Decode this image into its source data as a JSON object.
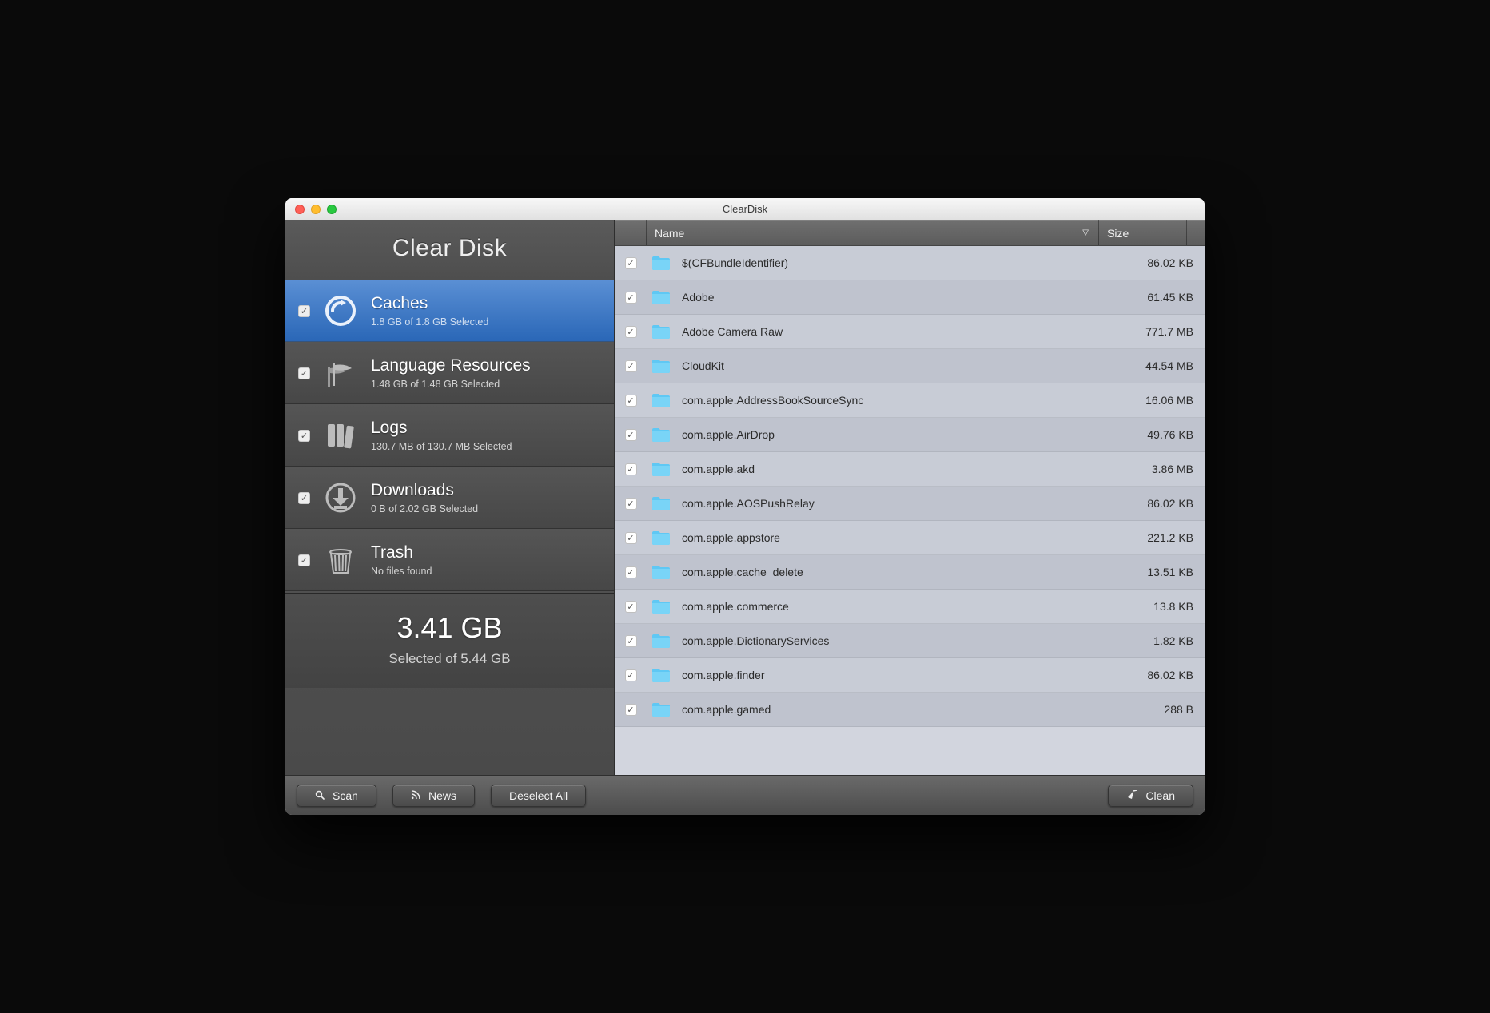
{
  "window": {
    "title": "ClearDisk"
  },
  "app_title": "Clear Disk",
  "categories": [
    {
      "title": "Caches",
      "sub": "1.8 GB of 1.8 GB Selected",
      "checked": true,
      "active": true,
      "icon": "caches"
    },
    {
      "title": "Language Resources",
      "sub": "1.48 GB of 1.48 GB Selected",
      "checked": true,
      "active": false,
      "icon": "language"
    },
    {
      "title": "Logs",
      "sub": "130.7 MB of 130.7 MB Selected",
      "checked": true,
      "active": false,
      "icon": "logs"
    },
    {
      "title": "Downloads",
      "sub": "0 B of 2.02 GB Selected",
      "checked": true,
      "active": false,
      "icon": "downloads"
    },
    {
      "title": "Trash",
      "sub": "No files found",
      "checked": true,
      "active": false,
      "icon": "trash"
    }
  ],
  "totals": {
    "big": "3.41 GB",
    "sub": "Selected of 5.44 GB"
  },
  "columns": {
    "name": "Name",
    "size": "Size"
  },
  "files": [
    {
      "name": "$(CFBundleIdentifier)",
      "size": "86.02 KB",
      "checked": true
    },
    {
      "name": "Adobe",
      "size": "61.45 KB",
      "checked": true
    },
    {
      "name": "Adobe Camera Raw",
      "size": "771.7 MB",
      "checked": true
    },
    {
      "name": "CloudKit",
      "size": "44.54 MB",
      "checked": true
    },
    {
      "name": "com.apple.AddressBookSourceSync",
      "size": "16.06 MB",
      "checked": true
    },
    {
      "name": "com.apple.AirDrop",
      "size": "49.76 KB",
      "checked": true
    },
    {
      "name": "com.apple.akd",
      "size": "3.86 MB",
      "checked": true
    },
    {
      "name": "com.apple.AOSPushRelay",
      "size": "86.02 KB",
      "checked": true
    },
    {
      "name": "com.apple.appstore",
      "size": "221.2 KB",
      "checked": true
    },
    {
      "name": "com.apple.cache_delete",
      "size": "13.51 KB",
      "checked": true
    },
    {
      "name": "com.apple.commerce",
      "size": "13.8 KB",
      "checked": true
    },
    {
      "name": "com.apple.DictionaryServices",
      "size": "1.82 KB",
      "checked": true
    },
    {
      "name": "com.apple.finder",
      "size": "86.02 KB",
      "checked": true
    },
    {
      "name": "com.apple.gamed",
      "size": "288 B",
      "checked": true
    }
  ],
  "buttons": {
    "scan": "Scan",
    "news": "News",
    "deselect": "Deselect All",
    "clean": "Clean"
  }
}
